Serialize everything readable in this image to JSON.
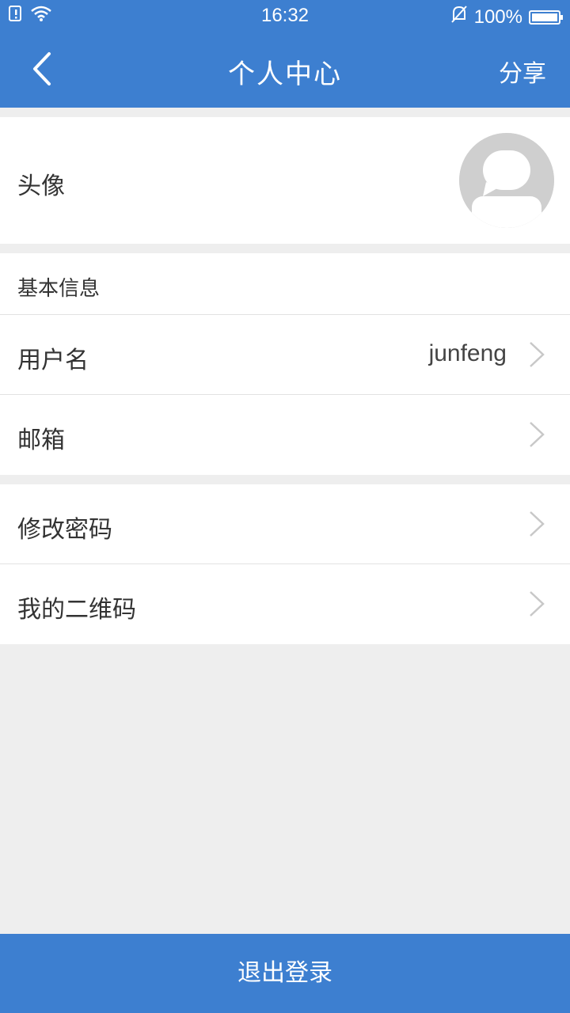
{
  "status_bar": {
    "time": "16:32",
    "battery": "100%",
    "icons": [
      "sim-alert-icon",
      "wifi-icon",
      "bell-muted-icon",
      "battery-icon"
    ]
  },
  "header": {
    "back_icon": "chevron-left-icon",
    "title": "个人中心",
    "share_label": "分享"
  },
  "avatar": {
    "label": "头像",
    "icon": "default-avatar-icon"
  },
  "basic_info": {
    "section_title": "基本信息",
    "rows": [
      {
        "label": "用户名",
        "value": "junfeng"
      },
      {
        "label": "邮箱",
        "value": ""
      }
    ]
  },
  "security": {
    "rows": [
      {
        "label": "修改密码"
      },
      {
        "label": "我的二维码"
      }
    ]
  },
  "logout_label": "退出登录",
  "colors": {
    "primary": "#3d7fd0",
    "background": "#eeeeee",
    "row_background": "#ffffff",
    "divider": "#e2e2e2",
    "chevron": "#c8c8c8"
  }
}
